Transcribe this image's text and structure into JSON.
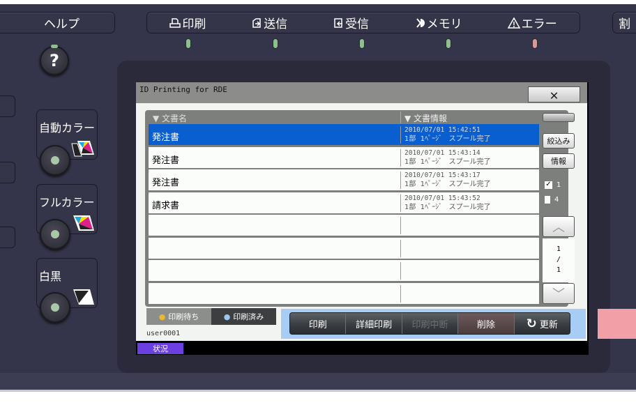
{
  "top_panel": {
    "help_label": "ヘルプ",
    "status_items": [
      {
        "icon": "printer-icon",
        "label": "印刷",
        "led": "#8fbf8f"
      },
      {
        "icon": "send-icon",
        "label": "送信",
        "led": "#8fbf8f"
      },
      {
        "icon": "receive-icon",
        "label": "受信",
        "led": "#8fbf8f"
      },
      {
        "icon": "memory-icon",
        "label": "メモリ",
        "led": "#8fbf8f"
      },
      {
        "icon": "warning-icon",
        "label": "エラー",
        "led": "#d89a96"
      }
    ],
    "right_partial_label": "割",
    "help_button": "?"
  },
  "color_modes": [
    {
      "label": "自動カラー",
      "icon": "auto-color-icon"
    },
    {
      "label": "フルカラー",
      "icon": "full-color-icon"
    },
    {
      "label": "白黒",
      "icon": "monochrome-icon"
    }
  ],
  "dialog": {
    "title": "ID Printing for RDE",
    "close": "✕",
    "columns": [
      "▼ 文書名",
      "▼ 文書情報"
    ],
    "rows": [
      {
        "name": "発注書",
        "date": "2010/07/01 15:42:51",
        "copies": "1部",
        "pages": "1ﾍﾟｰｼﾞ",
        "status": "スプール完了",
        "selected": true
      },
      {
        "name": "発注書",
        "date": "2010/07/01 15:43:14",
        "copies": "1部",
        "pages": "1ﾍﾟｰｼﾞ",
        "status": "スプール完了"
      },
      {
        "name": "発注書",
        "date": "2010/07/01 15:43:17",
        "copies": "1部",
        "pages": "1ﾍﾟｰｼﾞ",
        "status": "スプール完了"
      },
      {
        "name": "請求書",
        "date": "2010/07/01 15:43:52",
        "copies": "1部",
        "pages": "1ﾍﾟｰｼﾞ",
        "status": "スプール完了"
      }
    ],
    "empty_rows": 4,
    "filter_button": "絞込み",
    "info_button": "情報",
    "selected_count": "1",
    "total_count": "4",
    "page_current": "1",
    "page_sep": "/",
    "page_total": "1",
    "tabs": [
      {
        "label": "印刷待ち",
        "active": true
      },
      {
        "label": "印刷済み",
        "active": false
      }
    ],
    "user": "user0001",
    "actions": [
      {
        "label": "印刷",
        "state": "enabled"
      },
      {
        "label": "詳細印刷",
        "state": "enabled"
      },
      {
        "label": "印刷中断",
        "state": "disabled"
      },
      {
        "label": "削除",
        "state": "highlighted"
      },
      {
        "label": "更新",
        "state": "enabled",
        "icon": "refresh-icon"
      }
    ],
    "status_tab": "状況"
  },
  "colors": {
    "selection": "#0a5fd0",
    "status_tab": "#6b3fe0",
    "action_bar": "#a8cdf5",
    "delete_highlight": "#f2a0a8"
  }
}
